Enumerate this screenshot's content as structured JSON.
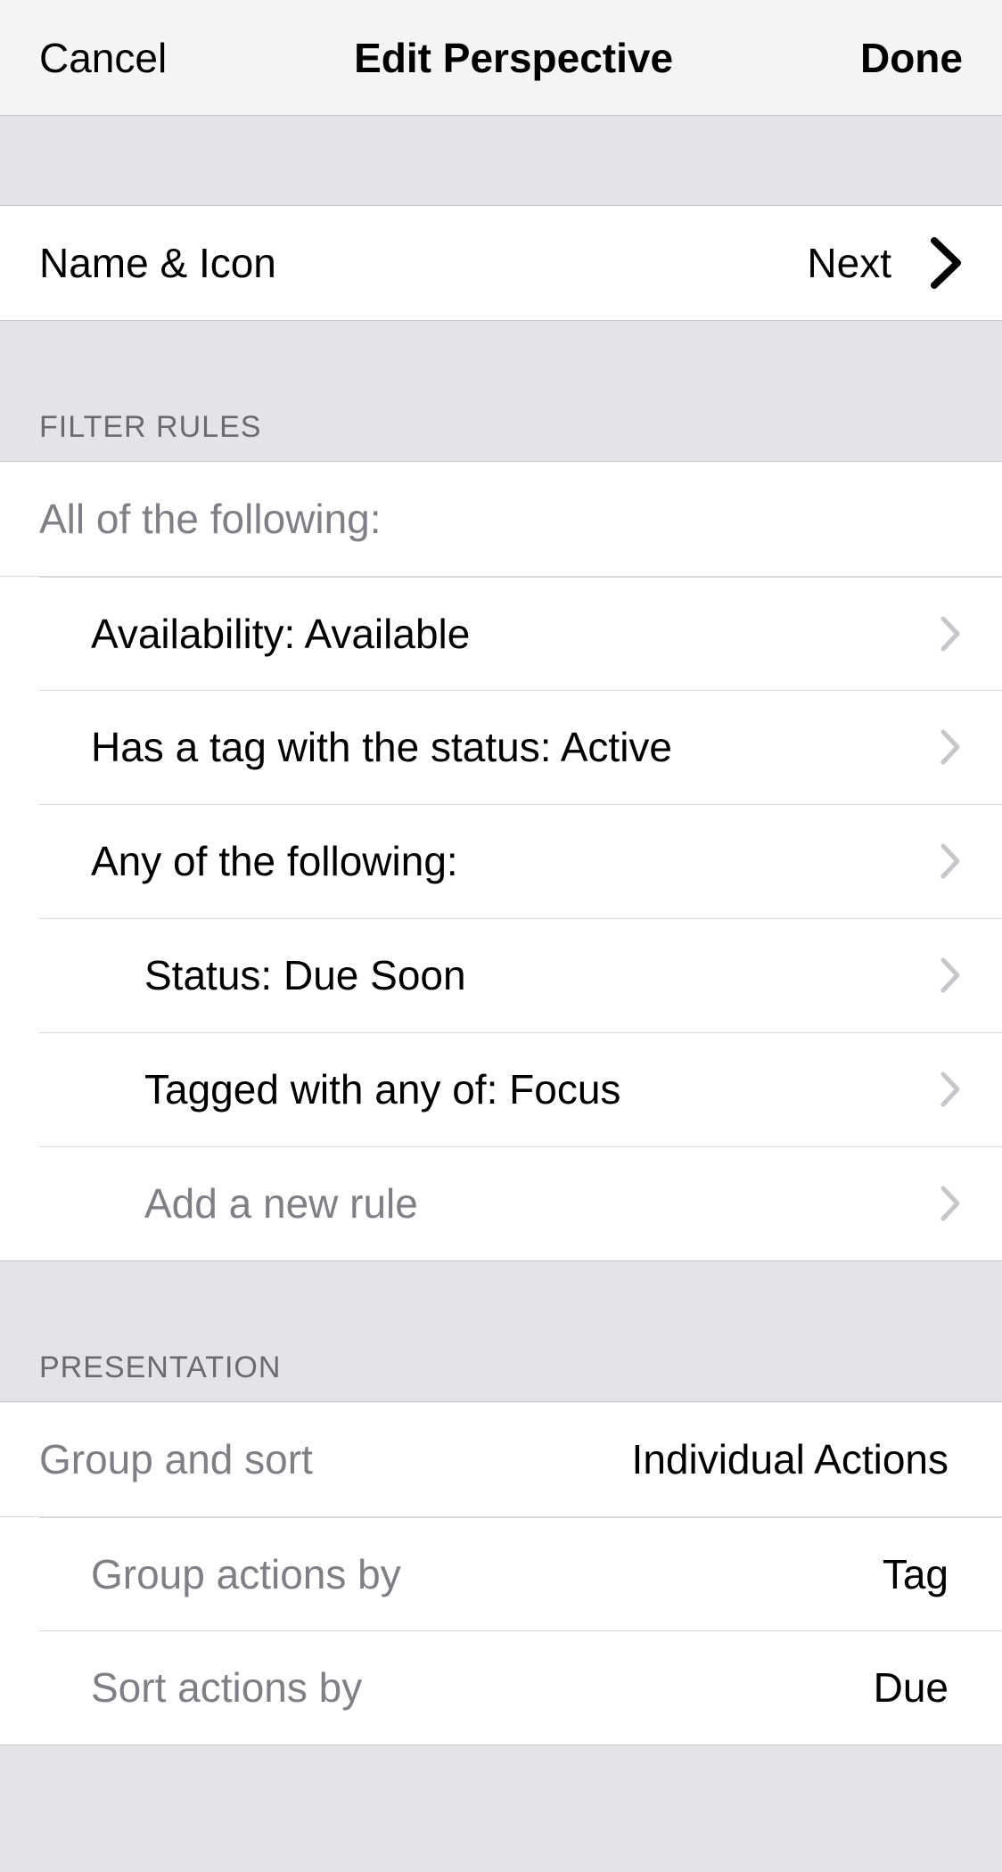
{
  "nav": {
    "cancel": "Cancel",
    "title": "Edit Perspective",
    "done": "Done"
  },
  "nameIcon": {
    "label": "Name & Icon",
    "value": "Next"
  },
  "filter": {
    "header": "FILTER RULES",
    "topRule": "All of the following:",
    "rules": [
      {
        "label": "Availability: Available",
        "indent": 1
      },
      {
        "label": "Has a tag with the status: Active",
        "indent": 1
      },
      {
        "label": "Any of the following:",
        "indent": 1
      },
      {
        "label": "Status: Due Soon",
        "indent": 2
      },
      {
        "label": "Tagged with any of: Focus",
        "indent": 2
      },
      {
        "label": "Add a new rule",
        "indent": 2,
        "grey": true
      }
    ]
  },
  "presentation": {
    "header": "PRESENTATION",
    "rows": [
      {
        "label": "Group and sort",
        "value": "Individual Actions",
        "indent": 0
      },
      {
        "label": "Group actions by",
        "value": "Tag",
        "indent": 1
      },
      {
        "label": "Sort actions by",
        "value": "Due",
        "indent": 1
      }
    ]
  }
}
